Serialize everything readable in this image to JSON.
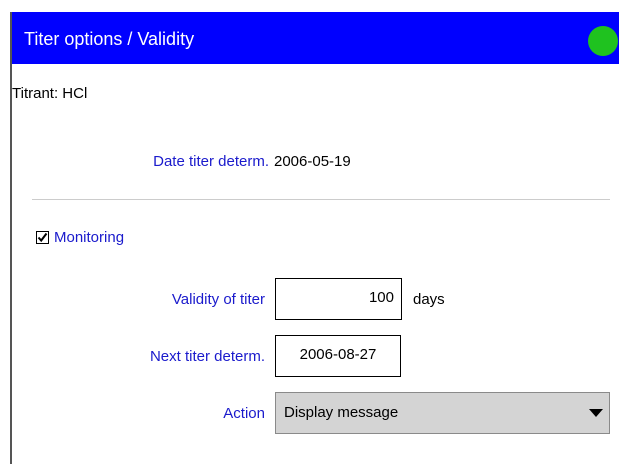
{
  "window": {
    "title": "Titer options / Validity",
    "status_color": "#1fc21f",
    "status_icon": "status-indicator-green"
  },
  "titrant": {
    "text": "Titrant: HCl"
  },
  "date_titer": {
    "label": "Date titer determ.",
    "value": "2006-05-19"
  },
  "monitoring": {
    "checked": true,
    "label": "Monitoring"
  },
  "validity": {
    "label": "Validity of titer",
    "value": "100",
    "unit": "days"
  },
  "next_titer": {
    "label": "Next titer determ.",
    "value": "2006-08-27"
  },
  "action": {
    "label": "Action",
    "selected": "Display message",
    "icon": "chevron-down-icon"
  }
}
